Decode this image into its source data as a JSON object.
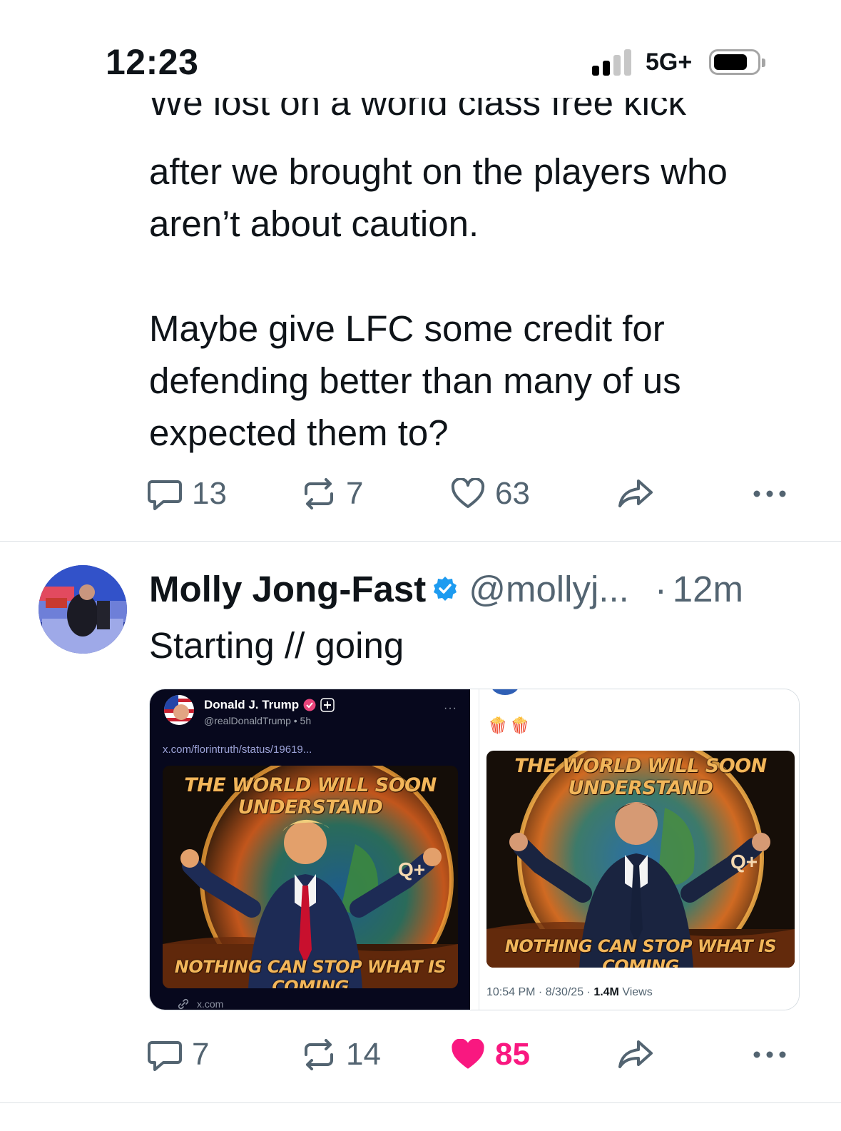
{
  "status_bar": {
    "time": "12:23",
    "network": "5G+",
    "signal_bars_filled": 2,
    "signal_bars_total": 4,
    "battery_icon": "battery-icon"
  },
  "tweet1": {
    "cut_line": "We lost on a world class free kick",
    "body_1": "after we brought on the players who aren’t about caution.",
    "body_2": "Maybe give LFC some credit for defending better than many of us expected them to?",
    "replies": "13",
    "reposts": "7",
    "likes": "63",
    "liked": false
  },
  "tweet2": {
    "name": "Molly Jong-Fast",
    "handle": "@mollyj...",
    "separator": "·",
    "time": "12m",
    "text": "Starting // going",
    "replies": "7",
    "reposts": "14",
    "likes": "85",
    "liked": true,
    "media": {
      "left": {
        "author": "Donald J. Trump",
        "handle_time": "@realDonaldTrump • 5h",
        "more": "···",
        "link": "x.com/florintruth/status/19619...",
        "poster_title": "THE WORLD WILL SOON UNDERSTAND",
        "poster_footer": "NOTHING CAN STOP WHAT IS COMING",
        "poster_mark": "Q+",
        "footer_domain": "x.com"
      },
      "right": {
        "emoji": "🍿🍿",
        "poster_title": "THE WORLD WILL SOON UNDERSTAND",
        "poster_footer": "NOTHING CAN STOP WHAT IS COMING",
        "poster_mark": "Q+",
        "timestamp": "10:54 PM · 8/30/25 · ",
        "views_count": "1.4M",
        "views_label": " Views"
      }
    }
  },
  "colors": {
    "text": "#0f1419",
    "secondary": "#536471",
    "like_pink": "#f91880",
    "verified_blue": "#1d9bf0",
    "divider": "#dfe3e6"
  }
}
